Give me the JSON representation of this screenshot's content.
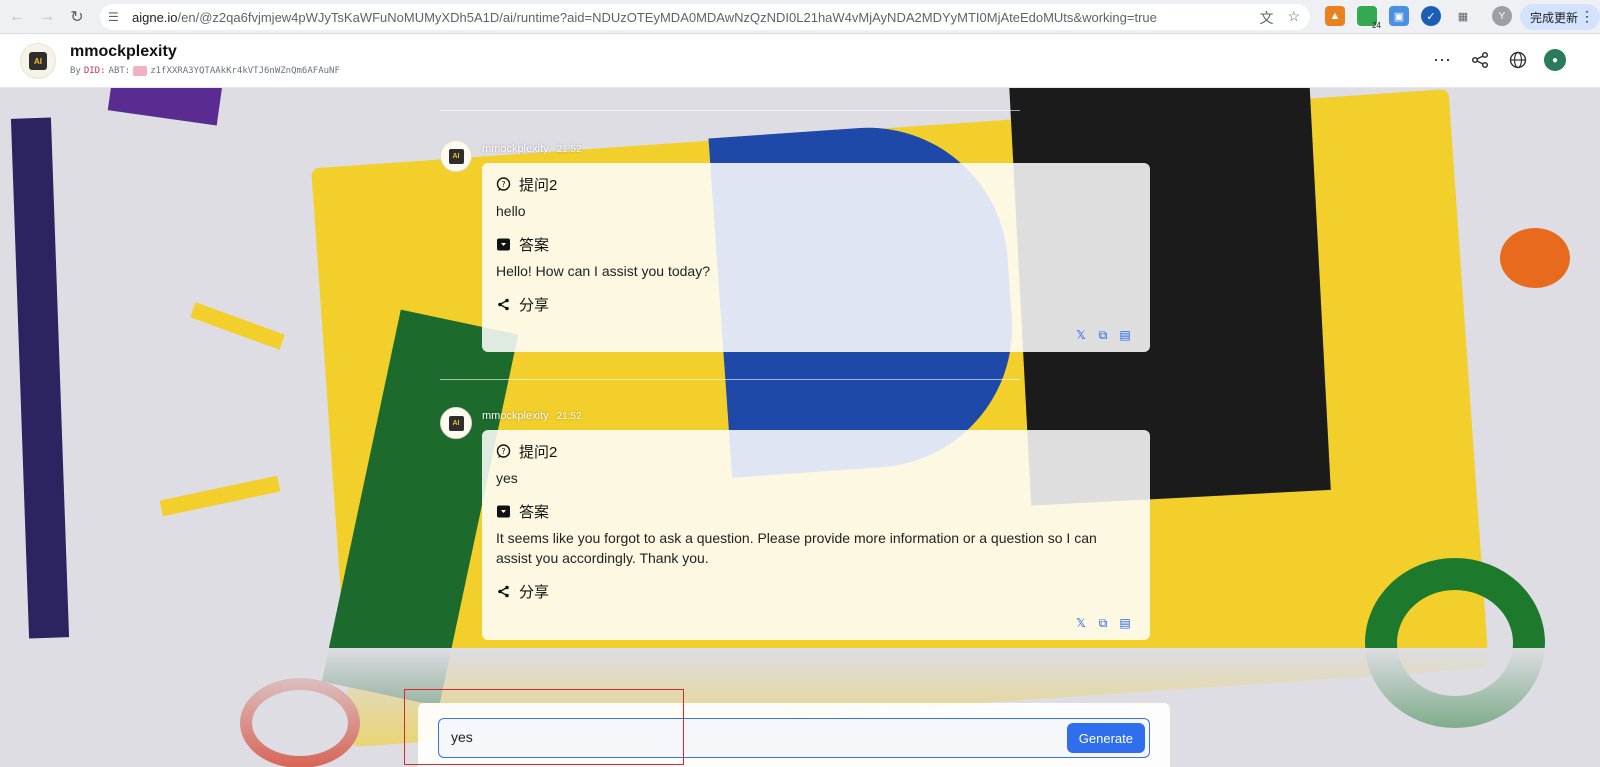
{
  "browser": {
    "url_host": "aigne.io",
    "url_path": "/en/@z2qa6fvjmjew4pWJyTsKaWFuNoMUMyXDh5A1D/ai/runtime?aid=NDUzOTEyMDA0MDAwNzQzNDI0L21haW4vMjAyNDA2MDYyMTI0MjAteEdoMUts&working=true",
    "update_label": "完成更新",
    "profile_initial": "Y",
    "ext_badge": "24"
  },
  "app": {
    "title": "mmockplexity",
    "by_label": "By",
    "did_prefix": "DID:",
    "did_abt": "ABT:",
    "did_value": "z1fXXRA3YQTAAkKr4kVTJ6nWZnQm6AFAuNF",
    "logo_text": "AI"
  },
  "messages": [
    {
      "name": "mmockplexity",
      "time": "21:52",
      "question_label": "提问2",
      "question": "hello",
      "answer_label": "答案",
      "answer": "Hello! How can I assist you today?",
      "share_label": "分享"
    },
    {
      "name": "mmockplexity",
      "time": "21:52",
      "question_label": "提问2",
      "question": "yes",
      "answer_label": "答案",
      "answer": "It seems like you forgot to ask a question. Please provide more information or a question so I can assist you accordingly. Thank you.",
      "share_label": "分享"
    }
  ],
  "input": {
    "value": "yes",
    "generate_label": "Generate"
  },
  "colors": {
    "accent": "#2f6fed",
    "highlight": "#e0262b"
  }
}
